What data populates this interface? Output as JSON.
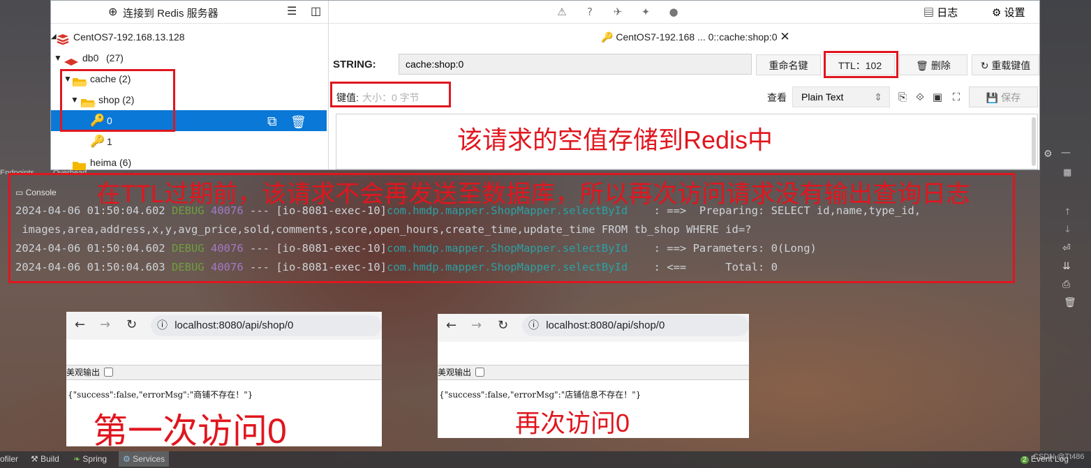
{
  "rdm": {
    "connect_label": "连接到 Redis 服务器",
    "tree": {
      "server": "CentOS7-192.168.13.128",
      "db": "db0",
      "db_count": "(27)",
      "folder_cache": "cache (2)",
      "folder_shop": "shop (2)",
      "key_0": "0",
      "key_1": "1",
      "folder_heima": "heima (6)"
    },
    "top_menu": {
      "log": "日志",
      "settings": "设置"
    },
    "tab_title": "CentOS7-192.168 ... 0::cache:shop:0",
    "type_label": "STRING:",
    "key_name": "cache:shop:0",
    "rename_button": "重命名键",
    "ttl_button": "TTL：102",
    "delete_button": "删除",
    "reload_button": "重载键值",
    "value_label": "键值:",
    "value_size": "大小：0 字节",
    "view_label": "查看",
    "view_mode": "Plain Text",
    "save_button": "保存"
  },
  "annotations": {
    "redis_note": "该请求的空值存储到Redis中",
    "console_note": "在TTL过期前，该请求不会再发送至数据库，所以再次访问请求没有输出查询日志",
    "first_visit": "第一次访问0",
    "second_visit": "再次访问0"
  },
  "ide": {
    "tabs_partial": [
      "Endpoints",
      "Overhead"
    ],
    "console_tab": "Console",
    "logs": [
      {
        "ts": "2024-04-06 01:50:04.602",
        "level": "DEBUG",
        "pid": "40076",
        "sep": " --- ",
        "thread": "[io-8081-exec-10]",
        "logger": "com.hmdp.mapper.ShopMapper.selectById",
        "msg": "    : ==>  Preparing: SELECT id,name,type_id,"
      },
      {
        "ts": "",
        "level": "",
        "pid": "",
        "sep": "",
        "thread": "",
        "logger": "",
        "msg": " images,area,address,x,y,avg_price,sold,comments,score,open_hours,create_time,update_time FROM tb_shop WHERE id=?"
      },
      {
        "ts": "2024-04-06 01:50:04.602",
        "level": "DEBUG",
        "pid": "40076",
        "sep": " --- ",
        "thread": "[io-8081-exec-10]",
        "logger": "com.hmdp.mapper.ShopMapper.selectById",
        "msg": "    : ==> Parameters: 0(Long)"
      },
      {
        "ts": "2024-04-06 01:50:04.603",
        "level": "DEBUG",
        "pid": "40076",
        "sep": " --- ",
        "thread": "[io-8081-exec-10]",
        "logger": "com.hmdp.mapper.ShopMapper.selectById",
        "msg": "    : <==      Total: 0"
      }
    ],
    "status_items": [
      "ofiler",
      "Build",
      "Spring",
      "Services"
    ],
    "event_log": "Event Log",
    "event_count": "2",
    "watermark": "CSDN @Tt486"
  },
  "browsers": [
    {
      "url": "localhost:8080/api/shop/0",
      "pretty_label": "美观输出",
      "json": "{\"success\":false,\"errorMsg\":\"商铺不存在！\"}"
    },
    {
      "url": "localhost:8080/api/shop/0",
      "pretty_label": "美观输出",
      "json": "{\"success\":false,\"errorMsg\":\"店铺信息不存在！\"}"
    }
  ],
  "colors": {
    "accent": "#0a78d7",
    "annotation": "#e0161e",
    "key_icon": "#f0a020",
    "folder": "#f5b800",
    "redis": "#d8352a"
  }
}
